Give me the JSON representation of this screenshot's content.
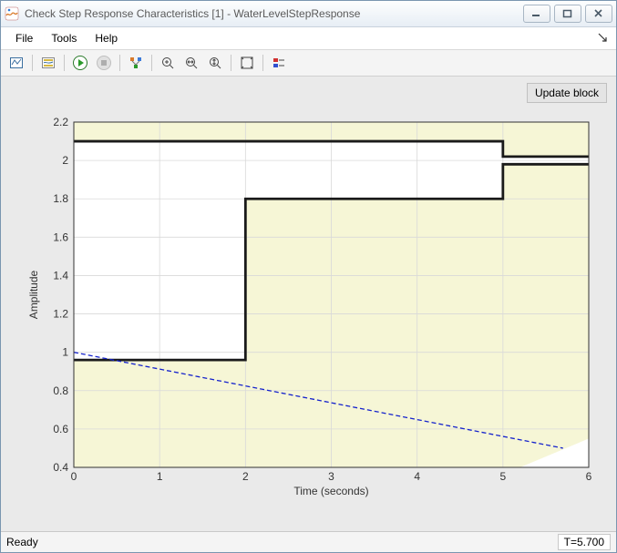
{
  "window": {
    "title": "Check Step Response Characteristics [1] - WaterLevelStepResponse"
  },
  "menu": {
    "file": "File",
    "tools": "Tools",
    "help": "Help"
  },
  "buttons": {
    "update_block": "Update block"
  },
  "status": {
    "ready": "Ready",
    "time": "T=5.700"
  },
  "axes": {
    "xlabel": "Time (seconds)",
    "ylabel": "Amplitude",
    "xticks": [
      "0",
      "1",
      "2",
      "3",
      "4",
      "5",
      "6"
    ],
    "yticks": [
      "0.4",
      "0.6",
      "0.8",
      "1",
      "1.2",
      "1.4",
      "1.6",
      "1.8",
      "2",
      "2.2"
    ]
  },
  "chart_data": {
    "type": "line",
    "title": "",
    "xlabel": "Time (seconds)",
    "ylabel": "Amplitude",
    "xlim": [
      0,
      6
    ],
    "ylim": [
      0.4,
      2.2
    ],
    "series": [
      {
        "name": "upper_bound",
        "style": "step-black-thick",
        "x": [
          0,
          5,
          5,
          6
        ],
        "y": [
          2.1,
          2.1,
          2.02,
          2.02
        ]
      },
      {
        "name": "lower_bound",
        "style": "step-black-thick",
        "x": [
          0,
          2,
          2,
          5,
          5,
          6
        ],
        "y": [
          0.96,
          0.96,
          1.8,
          1.8,
          1.98,
          1.98
        ]
      },
      {
        "name": "signal",
        "style": "blue-dashed",
        "x": [
          0,
          5.7
        ],
        "y": [
          1.0,
          0.5
        ]
      }
    ],
    "regions": [
      {
        "name": "upper_overshoot_region",
        "fill": "#f6f6d6",
        "polygon": [
          [
            0,
            2.1
          ],
          [
            5,
            2.1
          ],
          [
            5,
            2.02
          ],
          [
            6,
            2.02
          ],
          [
            6,
            2.2
          ],
          [
            0,
            2.2
          ]
        ]
      },
      {
        "name": "lower_undershoot_region",
        "fill": "#f6f6d6",
        "polygon": [
          [
            0,
            0.96
          ],
          [
            2,
            0.96
          ],
          [
            2,
            1.8
          ],
          [
            5,
            1.8
          ],
          [
            5,
            1.98
          ],
          [
            6,
            1.98
          ],
          [
            6,
            0.55
          ],
          [
            5.2,
            0.4
          ],
          [
            0,
            0.4
          ]
        ]
      }
    ]
  }
}
